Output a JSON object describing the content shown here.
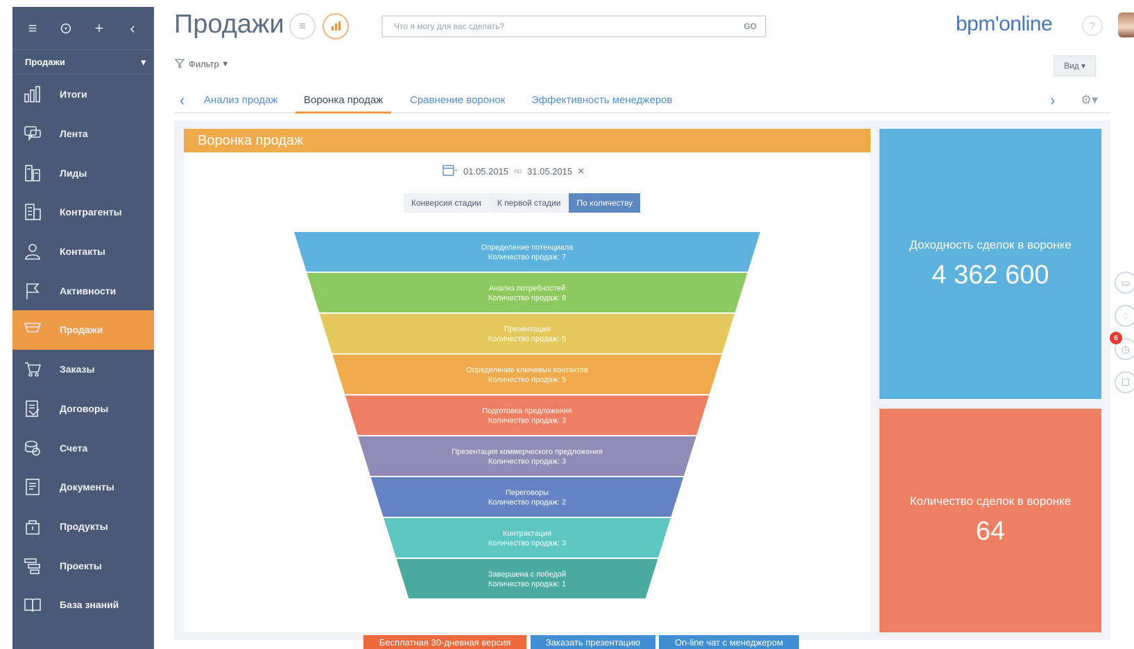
{
  "app": {
    "title": "Продажи",
    "logo": "bpm'online",
    "search_placeholder": "Что я могу для вас сделать?",
    "search_go": "GO",
    "help": "?"
  },
  "sidebar": {
    "section_label": "Продажи",
    "items": [
      {
        "label": "Итоги",
        "icon": "bar-chart-icon"
      },
      {
        "label": "Лента",
        "icon": "chat-icon"
      },
      {
        "label": "Лиды",
        "icon": "leads-icon"
      },
      {
        "label": "Контрагенты",
        "icon": "building-icon"
      },
      {
        "label": "Контакты",
        "icon": "person-icon"
      },
      {
        "label": "Активности",
        "icon": "flag-icon"
      },
      {
        "label": "Продажи",
        "icon": "funnel-icon",
        "active": true
      },
      {
        "label": "Заказы",
        "icon": "cart-icon"
      },
      {
        "label": "Договоры",
        "icon": "contract-icon"
      },
      {
        "label": "Счета",
        "icon": "invoice-icon"
      },
      {
        "label": "Документы",
        "icon": "document-icon"
      },
      {
        "label": "Продукты",
        "icon": "box-icon"
      },
      {
        "label": "Проекты",
        "icon": "projects-icon"
      },
      {
        "label": "База знаний",
        "icon": "book-icon"
      }
    ]
  },
  "toolbar": {
    "filter_label": "Фильтр",
    "view_label": "Вид"
  },
  "tabs": [
    {
      "label": "Анализ продаж",
      "active": false
    },
    {
      "label": "Воронка продаж",
      "active": true
    },
    {
      "label": "Сравнение воронок",
      "active": false
    },
    {
      "label": "Эффективность менеджеров",
      "active": false
    }
  ],
  "funnel_widget": {
    "header": "Воронка продаж",
    "date_from": "01.05.2015",
    "date_sep": "по",
    "date_to": "31.05.2015",
    "modes": [
      {
        "label": "Конверсия стадии",
        "active": false
      },
      {
        "label": "К первой стадии",
        "active": false
      },
      {
        "label": "По количеству",
        "active": true
      }
    ]
  },
  "chart_data": {
    "type": "funnel",
    "title": "Воронка продаж",
    "value_label": "Количество продаж",
    "stages": [
      {
        "name": "Определение потенциала",
        "value": 7,
        "color": "#5cb2dc"
      },
      {
        "name": "Анализ потребностей",
        "value": 8,
        "color": "#8cc95e"
      },
      {
        "name": "Презентация",
        "value": 5,
        "color": "#e6c95c"
      },
      {
        "name": "Определение ключевых контактов",
        "value": 5,
        "color": "#eeaa4b"
      },
      {
        "name": "Подготовка предложения",
        "value": 3,
        "color": "#ee7f62"
      },
      {
        "name": "Презентация коммерческого предложения",
        "value": 3,
        "color": "#8f8ab6"
      },
      {
        "name": "Переговоры",
        "value": 2,
        "color": "#6583c2"
      },
      {
        "name": "Контрактация",
        "value": 3,
        "color": "#5cc7c1"
      },
      {
        "name": "Завершена с победой",
        "value": 1,
        "color": "#4aaa9f"
      }
    ]
  },
  "kpis": [
    {
      "label": "Доходность сделок в воронке",
      "value": "4 362 600"
    },
    {
      "label": "Количество сделок в воронке",
      "value": "64"
    }
  ],
  "notifications": {
    "badge_count": "6"
  },
  "cta": {
    "trial": "Бесплатная 30-дневная версия",
    "demo": "Заказать презентацию",
    "chat": "On-line чат с менеджером"
  }
}
